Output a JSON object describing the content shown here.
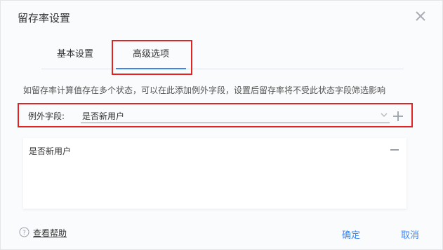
{
  "dialog": {
    "title": "留存率设置",
    "close_icon": "close-icon"
  },
  "tabs": [
    {
      "label": "基本设置",
      "active": false
    },
    {
      "label": "高级选项",
      "active": true
    }
  ],
  "description": "如留存率计算值存在多个状态，可以在此添加例外字段，设置后留存率将不受此状态字段筛选影响",
  "exception_field": {
    "label": "例外字段:",
    "selected_value": "是否新用户",
    "dropdown_icon": "chevron-down-icon",
    "add_icon": "plus-icon"
  },
  "exception_list": [
    {
      "label": "是否新用户",
      "remove_icon": "minus-icon"
    }
  ],
  "footer": {
    "help_label": "查看帮助",
    "help_icon": "question-circle-icon",
    "confirm_label": "确定",
    "cancel_label": "取消"
  },
  "colors": {
    "accent": "#3d85f0",
    "highlight_box": "#e02424"
  }
}
